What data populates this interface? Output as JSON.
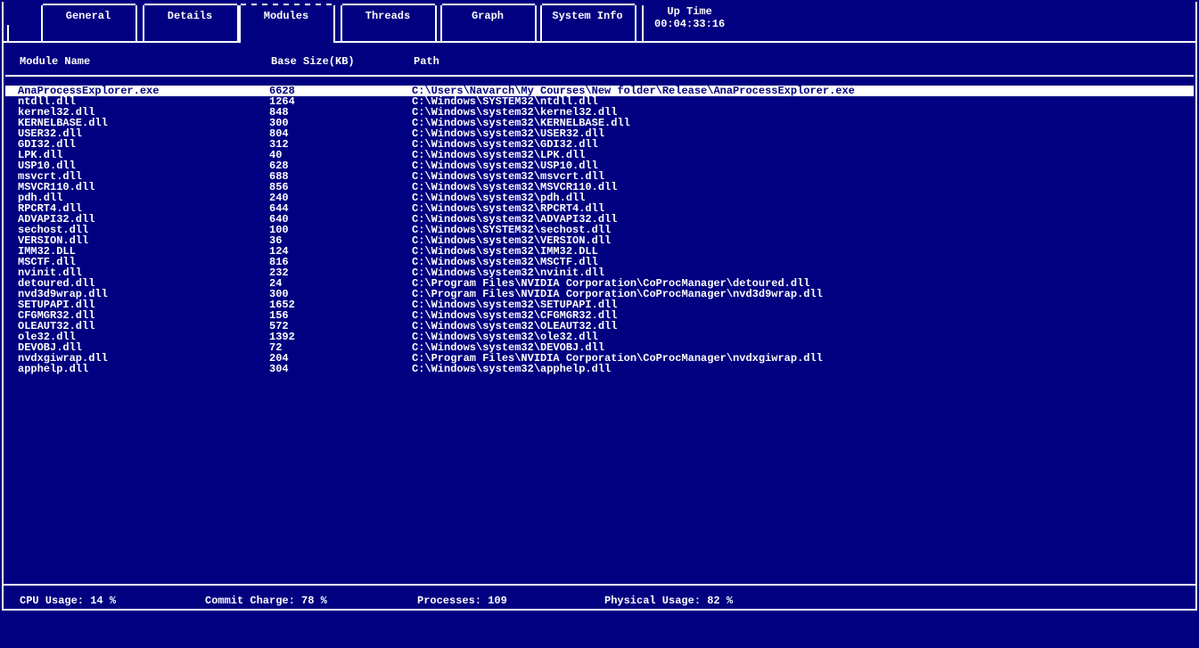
{
  "tabs": [
    {
      "label": "General"
    },
    {
      "label": "Details"
    },
    {
      "label": "Modules"
    },
    {
      "label": "Threads"
    },
    {
      "label": "Graph"
    },
    {
      "label": "System Info"
    }
  ],
  "active_tab_index": 2,
  "uptime": {
    "label": "Up Time",
    "value": "00:04:33:16"
  },
  "columns": {
    "name": "Module Name",
    "size": "Base Size(KB)",
    "path": "Path"
  },
  "selected_row_index": 0,
  "rows": [
    {
      "name": "AnaProcessExplorer.exe",
      "size": "6628",
      "path": "C:\\Users\\Navarch\\My Courses\\New folder\\Release\\AnaProcessExplorer.exe"
    },
    {
      "name": "ntdll.dll",
      "size": "1264",
      "path": "C:\\Windows\\SYSTEM32\\ntdll.dll"
    },
    {
      "name": "kernel32.dll",
      "size": "848",
      "path": "C:\\Windows\\system32\\kernel32.dll"
    },
    {
      "name": "KERNELBASE.dll",
      "size": "300",
      "path": "C:\\Windows\\system32\\KERNELBASE.dll"
    },
    {
      "name": "USER32.dll",
      "size": "804",
      "path": "C:\\Windows\\system32\\USER32.dll"
    },
    {
      "name": "GDI32.dll",
      "size": "312",
      "path": "C:\\Windows\\system32\\GDI32.dll"
    },
    {
      "name": "LPK.dll",
      "size": "40",
      "path": "C:\\Windows\\system32\\LPK.dll"
    },
    {
      "name": "USP10.dll",
      "size": "628",
      "path": "C:\\Windows\\system32\\USP10.dll"
    },
    {
      "name": "msvcrt.dll",
      "size": "688",
      "path": "C:\\Windows\\system32\\msvcrt.dll"
    },
    {
      "name": "MSVCR110.dll",
      "size": "856",
      "path": "C:\\Windows\\system32\\MSVCR110.dll"
    },
    {
      "name": "pdh.dll",
      "size": "240",
      "path": "C:\\Windows\\system32\\pdh.dll"
    },
    {
      "name": "RPCRT4.dll",
      "size": "644",
      "path": "C:\\Windows\\system32\\RPCRT4.dll"
    },
    {
      "name": "ADVAPI32.dll",
      "size": "640",
      "path": "C:\\Windows\\system32\\ADVAPI32.dll"
    },
    {
      "name": "sechost.dll",
      "size": "100",
      "path": "C:\\Windows\\SYSTEM32\\sechost.dll"
    },
    {
      "name": "VERSION.dll",
      "size": "36",
      "path": "C:\\Windows\\system32\\VERSION.dll"
    },
    {
      "name": "IMM32.DLL",
      "size": "124",
      "path": "C:\\Windows\\system32\\IMM32.DLL"
    },
    {
      "name": "MSCTF.dll",
      "size": "816",
      "path": "C:\\Windows\\system32\\MSCTF.dll"
    },
    {
      "name": "nvinit.dll",
      "size": "232",
      "path": "C:\\Windows\\system32\\nvinit.dll"
    },
    {
      "name": "detoured.dll",
      "size": "24",
      "path": "C:\\Program Files\\NVIDIA Corporation\\CoProcManager\\detoured.dll"
    },
    {
      "name": "nvd3d9wrap.dll",
      "size": "300",
      "path": "C:\\Program Files\\NVIDIA Corporation\\CoProcManager\\nvd3d9wrap.dll"
    },
    {
      "name": "SETUPAPI.dll",
      "size": "1652",
      "path": "C:\\Windows\\system32\\SETUPAPI.dll"
    },
    {
      "name": "CFGMGR32.dll",
      "size": "156",
      "path": "C:\\Windows\\system32\\CFGMGR32.dll"
    },
    {
      "name": "OLEAUT32.dll",
      "size": "572",
      "path": "C:\\Windows\\system32\\OLEAUT32.dll"
    },
    {
      "name": "ole32.dll",
      "size": "1392",
      "path": "C:\\Windows\\system32\\ole32.dll"
    },
    {
      "name": "DEVOBJ.dll",
      "size": "72",
      "path": "C:\\Windows\\system32\\DEVOBJ.dll"
    },
    {
      "name": "nvdxgiwrap.dll",
      "size": "204",
      "path": "C:\\Program Files\\NVIDIA Corporation\\CoProcManager\\nvdxgiwrap.dll"
    },
    {
      "name": "apphelp.dll",
      "size": "304",
      "path": "C:\\Windows\\system32\\apphelp.dll"
    }
  ],
  "status": {
    "cpu": "CPU Usage: 14 %",
    "commit": "Commit Charge: 78 %",
    "procs": "Processes: 109",
    "phys": "Physical Usage: 82 %"
  }
}
